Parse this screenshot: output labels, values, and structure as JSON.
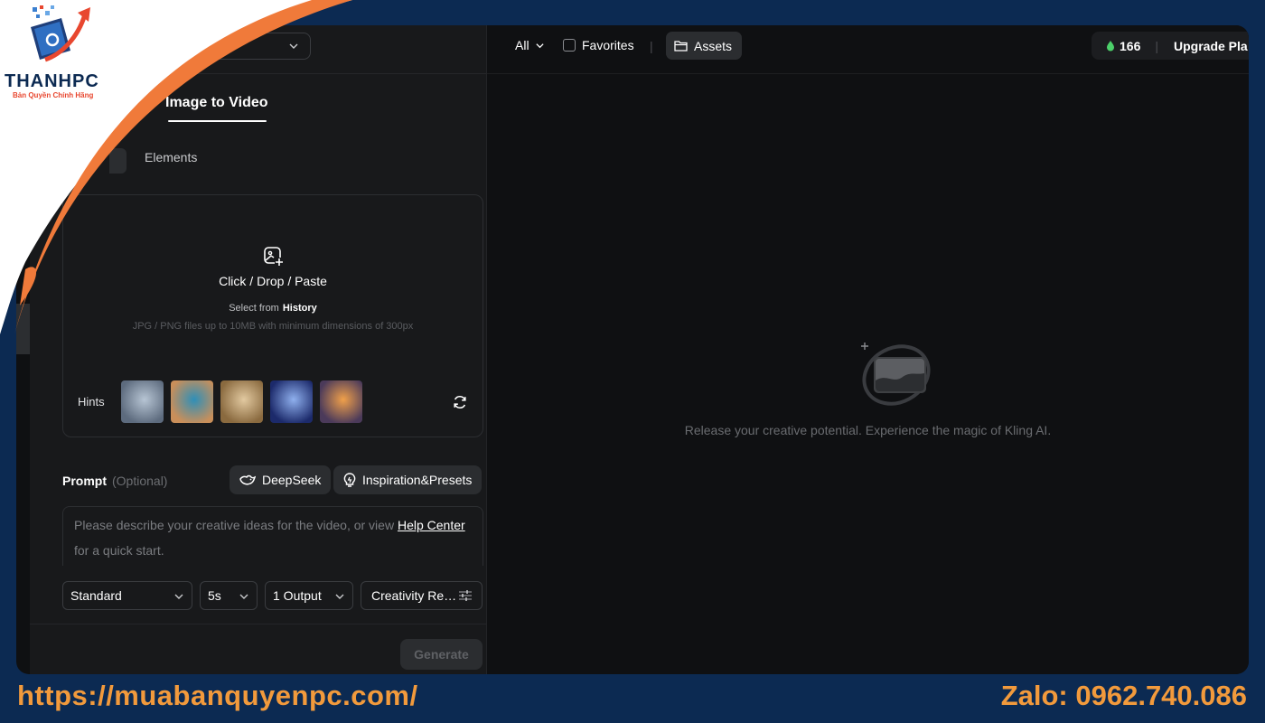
{
  "left_panel": {
    "tab_active": "Image to Video",
    "subtab": "Elements",
    "upload": {
      "title": "Click / Drop / Paste",
      "select_from": "Select from",
      "history_link": "History",
      "hint": "JPG / PNG files up to 10MB with minimum dimensions of 300px"
    },
    "hints_label": "Hints",
    "hints": [
      {
        "name": "castle-in-fog",
        "colors": [
          "#5d6b7e",
          "#b7c5d4"
        ]
      },
      {
        "name": "hamster-on-float",
        "colors": [
          "#c98f5a",
          "#2f8fb8"
        ]
      },
      {
        "name": "fluffy-cat",
        "colors": [
          "#8a6a3f",
          "#e2c9a0"
        ]
      },
      {
        "name": "blue-fantasy-figure",
        "colors": [
          "#1c2a6b",
          "#8fb0ee"
        ]
      },
      {
        "name": "fire-sparks",
        "colors": [
          "#4b3a5a",
          "#f0a04a"
        ]
      }
    ],
    "prompt": {
      "label": "Prompt",
      "optional": "(Optional)",
      "deepseek_label": "DeepSeek",
      "presets_label": "Inspiration&Presets",
      "placeholder_start": "Please describe your creative ideas for the video, or view",
      "help_link": "Help Center",
      "placeholder_end": "for a quick start."
    },
    "settings": {
      "mode": "Standard",
      "duration": "5s",
      "outputs": "1 Output",
      "creativity": "Creativity Re…"
    },
    "generate_label": "Generate"
  },
  "right_panel": {
    "filter_all": "All",
    "favorites": "Favorites",
    "divider": "|",
    "assets": "Assets",
    "credits": "166",
    "upgrade": "Upgrade Pla",
    "empty_message": "Release your creative potential. Experience the magic of Kling AI."
  },
  "watermark": {
    "logo_text": "THANHPC",
    "logo_subtitle": "Bản Quyền Chính Hãng",
    "url": "https://muabanquyenpc.com/",
    "zalo": "Zalo: 0962.740.086"
  },
  "colors": {
    "page_bg": "#0c2a52",
    "panel_bg": "#18191b",
    "canvas_bg": "#0f1012",
    "accent_orange": "#f29a3c",
    "swoosh_orange": "#f07a3a",
    "credit_green": "#4cd06a"
  }
}
